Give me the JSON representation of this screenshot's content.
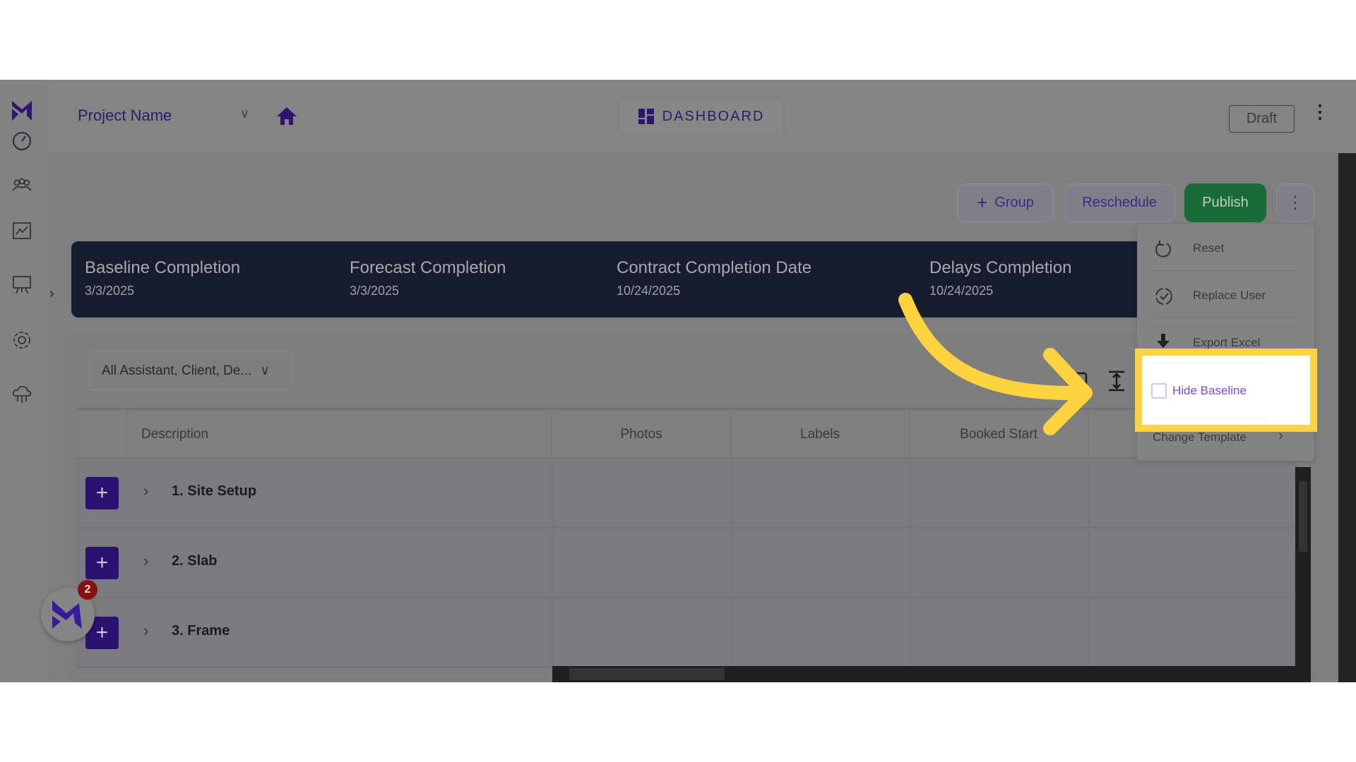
{
  "header": {
    "project_name": "Project Name",
    "dashboard_label": "DASHBOARD",
    "draft_label": "Draft"
  },
  "sidebar": {
    "items": [
      "dashboard-gauge",
      "team",
      "analytics",
      "presentation",
      "settings",
      "cloud-network"
    ]
  },
  "toolbar": {
    "group_label": "Group",
    "reschedule_label": "Reschedule",
    "publish_label": "Publish"
  },
  "banner": [
    {
      "label": "Baseline Completion",
      "value": "3/3/2025"
    },
    {
      "label": "Forecast Completion",
      "value": "3/3/2025"
    },
    {
      "label": "Contract Completion Date",
      "value": "10/24/2025"
    },
    {
      "label": "Delays Completion",
      "value": "10/24/2025"
    }
  ],
  "filter": {
    "value": "All Assistant, Client, De..."
  },
  "table": {
    "columns": [
      "Description",
      "Photos",
      "Labels",
      "Booked Start"
    ],
    "rows": [
      "1. Site Setup",
      "2. Slab",
      "3. Frame"
    ]
  },
  "menu": {
    "reset": "Reset",
    "replace_user": "Replace User",
    "export_excel": "Export Excel",
    "hide_baseline": "Hide Baseline",
    "change_template": "Change Template"
  },
  "chat": {
    "badge": "2"
  },
  "colors": {
    "brand": "#3b1aa8",
    "publish": "#1e7a3e",
    "highlight": "#ffd23f",
    "banner": "#171c2e"
  }
}
